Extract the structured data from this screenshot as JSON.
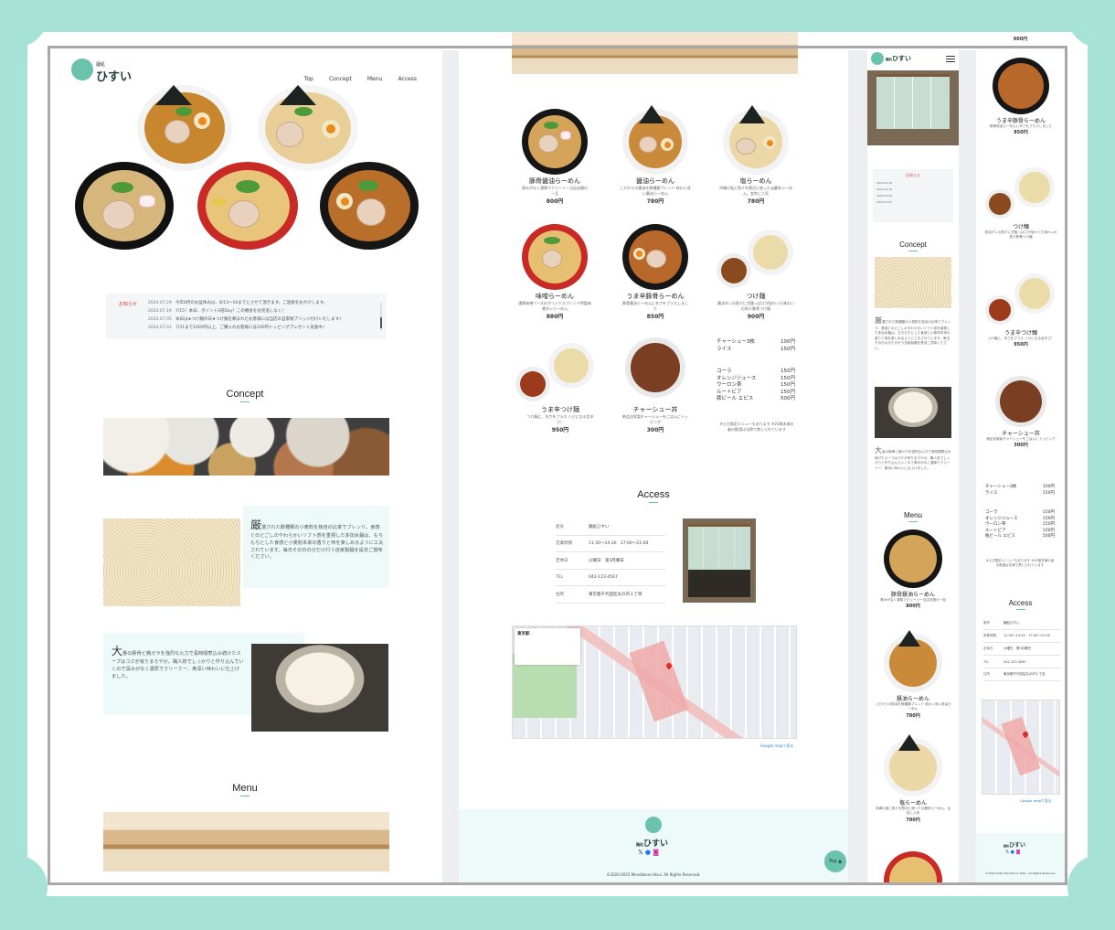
{
  "site": {
    "logo_small": "麺処",
    "logo_big": "ひすい"
  },
  "nav": [
    "Top",
    "Concept",
    "Menu",
    "Access"
  ],
  "news": {
    "label": "お知らせ",
    "items": [
      {
        "date": "2024.07.29",
        "text": "今年8月のお盆休みは、8/13〜16までとさせて頂きます。ご迷惑をおかけします。"
      },
      {
        "date": "2024.07.19",
        "text": "7/15！本日、ポイント2倍Day！この機会をお見逃しなく！"
      },
      {
        "date": "2024.07.05",
        "text": "本日は★つけ麺の日★つけ麺を頼まれたお客様には当店の自家製ブリッジ付けいたします♪"
      },
      {
        "date": "2024.07.01",
        "text": "7/31まで1000円以上、ご購入のお客様には100円トッピングプレゼント実施中♪"
      }
    ]
  },
  "sections": {
    "concept": "Concept",
    "menu": "Menu",
    "access": "Access"
  },
  "concept": {
    "p1_initial": "厳",
    "p1": "選された数種類の小麦粉を独自の比率でブレンド。食感とのどごしのやわらかいソフト感を重視した多加水麺は、もちもちとした食感と小麦粉本来の香りと味を楽しめるように工夫されています。毎日その日の分だけ行う自家製麺を是非ご賞味ください。",
    "p2_initial": "大",
    "p2": "量の豚骨と鶏ガラを強烈な火力で長時間煮込み続けたスープはコクが有りまろやか。職人技でしっかりと作り込んでいくので臭みがなく濃厚でクリーミー、奥深い味わいに仕上げました。"
  },
  "menu": [
    {
      "name": "豚骨醤油らーめん",
      "desc": "臭みがなく濃厚でクリーミー当店自慢の一品",
      "price": "800円"
    },
    {
      "name": "醤油らーめん",
      "desc": "こだわりの醤油を数種類ブレンド 味わい深い醤油らーめん",
      "price": "780円"
    },
    {
      "name": "塩らーめん",
      "desc": "沖縄の塩と魚介を贅沢に使った淡麗系らーめん。女性に人気",
      "price": "780円"
    },
    {
      "name": "味噌らーめん",
      "desc": "濃厚味噌ベースのオリジナルブレンド特製味噌ダレらーめん",
      "price": "880円"
    },
    {
      "name": "うま辛豚骨らーめん",
      "desc": "豚骨醤油らーめんに辛さをプラスしました",
      "price": "850円"
    },
    {
      "name": "つけ麺",
      "desc": "醤油ダレの魚介に甘酸っぱさが加わった味わいの魚介豚骨つけ麺",
      "price": "900円"
    },
    {
      "name": "うま辛つけ麺",
      "desc": "つけ麺に、辛さをプラス くせになる旨辛さ！",
      "price": "950円"
    },
    {
      "name": "チャーシュー丼",
      "desc": "絶品自家製チャーシューをごはんにトッピング",
      "price": "300円"
    }
  ],
  "sides": [
    {
      "name": "チャーシュー3枚",
      "price": "100円"
    },
    {
      "name": "ライス",
      "price": "150円"
    }
  ],
  "drinks": [
    {
      "name": "コーラ",
      "price": "150円"
    },
    {
      "name": "オレンジジュース",
      "price": "150円"
    },
    {
      "name": "ウーロン茶",
      "price": "150円"
    },
    {
      "name": "ルートビア",
      "price": "150円"
    },
    {
      "name": "瓶ビール エビス",
      "price": "500円"
    }
  ],
  "menu_note": "※土日限定メニューもあります ※20歳未満の者の飲酒は法律で禁じられています",
  "access": [
    {
      "key": "屋号",
      "value": "麺処ひすい"
    },
    {
      "key": "営業時間",
      "value": "11:30〜14:30　17:00〜21:00"
    },
    {
      "key": "定休日",
      "value": "火曜日　第3月曜日"
    },
    {
      "key": "TEL",
      "value": "042-123-4567"
    },
    {
      "key": "住所",
      "value": "東京都千代田区丸の内１丁目"
    }
  ],
  "map": {
    "place": "東京駅",
    "link": "Google mapで見る"
  },
  "footer": {
    "copyright": "©2020-2025 Mendokoro Hisui. All Rights Reserved.",
    "top_label": "Top"
  },
  "colors": {
    "accent": "#6bc3ad",
    "backdrop": "#a6e3d6"
  }
}
